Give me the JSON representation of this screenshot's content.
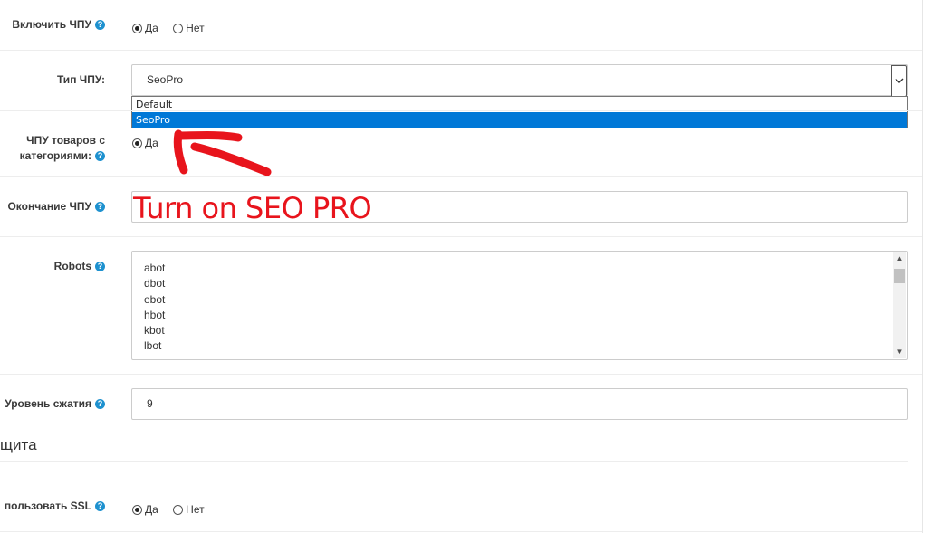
{
  "fields": {
    "enable_seo": {
      "label": "Включить ЧПУ",
      "options": [
        "Да",
        "Нет"
      ],
      "selected": "Да"
    },
    "seo_type": {
      "label": "Тип ЧПУ:",
      "value": "SeoPro",
      "dropdown_options": [
        "Default",
        "SeoPro"
      ],
      "highlighted_option": "SeoPro",
      "arrow": "chevron-down-icon"
    },
    "products_with_categories": {
      "label_line1": "ЧПУ товаров с",
      "label_line2": "категориями:",
      "options": [
        "Да"
      ],
      "selected": "Да"
    },
    "seo_suffix": {
      "label": "Окончание ЧПУ",
      "value": ""
    },
    "robots": {
      "label": "Robots",
      "lines": [
        "abot",
        "dbot",
        "ebot",
        "hbot",
        "kbot",
        "lbot"
      ]
    },
    "compression": {
      "label": "Уровень сжатия",
      "value": "9"
    },
    "use_ssl": {
      "label": "пользовать SSL",
      "options": [
        "Да",
        "Нет"
      ],
      "selected": "Да"
    }
  },
  "section": {
    "title": "щита"
  },
  "annotation": {
    "text": "Turn on SEO PRO",
    "color": "#e8141c"
  },
  "icons": {
    "help": "question-circle-icon"
  }
}
